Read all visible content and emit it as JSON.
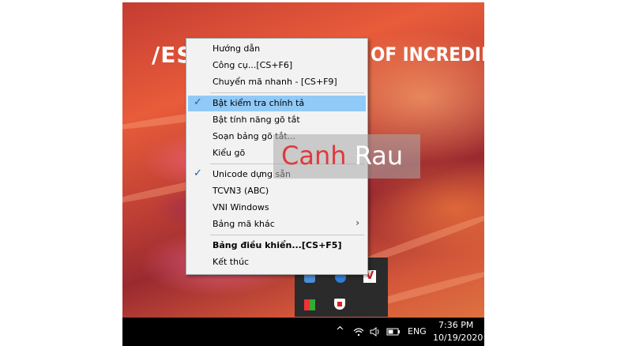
{
  "wallpaper": {
    "brand_left": "/ES",
    "brand_right": "OF INCREDIBL"
  },
  "menu": {
    "items": [
      {
        "label": "Hướng dẫn",
        "checked": false,
        "highlighted": false,
        "submenu": false,
        "bold": false
      },
      {
        "label": "Công cụ...[CS+F6]",
        "checked": false,
        "highlighted": false,
        "submenu": false,
        "bold": false
      },
      {
        "label": "Chuyển mã nhanh - [CS+F9]",
        "checked": false,
        "highlighted": false,
        "submenu": false,
        "bold": false
      },
      {
        "label": "Bật kiểm tra chính tả",
        "checked": true,
        "highlighted": true,
        "submenu": false,
        "bold": false
      },
      {
        "label": "Bật tính năng gõ tắt",
        "checked": false,
        "highlighted": false,
        "submenu": false,
        "bold": false
      },
      {
        "label": "Soạn bảng gõ tắt...",
        "checked": false,
        "highlighted": false,
        "submenu": false,
        "bold": false
      },
      {
        "label": "Kiểu gõ",
        "checked": false,
        "highlighted": false,
        "submenu": true,
        "bold": false
      },
      {
        "label": "Unicode dựng sẵn",
        "checked": true,
        "highlighted": false,
        "submenu": false,
        "bold": false
      },
      {
        "label": "TCVN3 (ABC)",
        "checked": false,
        "highlighted": false,
        "submenu": false,
        "bold": false
      },
      {
        "label": "VNI Windows",
        "checked": false,
        "highlighted": false,
        "submenu": false,
        "bold": false
      },
      {
        "label": "Bảng mã khác",
        "checked": false,
        "highlighted": false,
        "submenu": true,
        "bold": false
      },
      {
        "label": "Bảng điều khiển...[CS+F5]",
        "checked": false,
        "highlighted": false,
        "submenu": false,
        "bold": true
      },
      {
        "label": "Kết thúc",
        "checked": false,
        "highlighted": false,
        "submenu": false,
        "bold": false
      }
    ],
    "check_glyph": "✓",
    "arrow_glyph": "›"
  },
  "watermark": {
    "word1": "Canh",
    "word2": "Rau",
    "accent_color": "#e0393e"
  },
  "tray_popup": {
    "icons": [
      "network-app-icon",
      "bluetooth-icon",
      "unikey-v-icon",
      "color-app-icon",
      "shield-app-icon"
    ]
  },
  "taskbar": {
    "up_arrow": "^",
    "wifi_icon": "wifi-icon",
    "volume_icon": "volume-icon",
    "battery_icon": "battery-icon",
    "language": "ENG",
    "time": "7:36 PM",
    "date": "10/19/2020"
  }
}
